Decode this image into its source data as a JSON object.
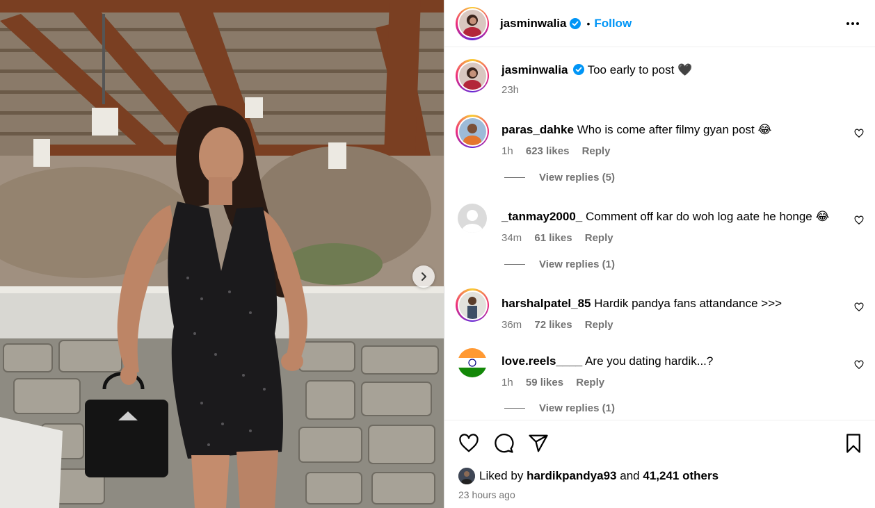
{
  "post": {
    "author": "jasminwalia",
    "follow_label": "Follow",
    "separator": "•",
    "caption": "Too early to post 🖤",
    "caption_time": "23h"
  },
  "comments": [
    {
      "user": "paras_dahke",
      "text": "Who is come after filmy gyan post 😂",
      "time": "1h",
      "likes": "623 likes",
      "reply": "Reply",
      "view_replies": "View replies (5)"
    },
    {
      "user": "_tanmay2000_",
      "text": "Comment off kar do woh log aate he honge 😂",
      "time": "34m",
      "likes": "61 likes",
      "reply": "Reply",
      "view_replies": "View replies (1)"
    },
    {
      "user": "harshalpatel_85",
      "text": "Hardik pandya fans attandance >>>",
      "time": "36m",
      "likes": "72 likes",
      "reply": "Reply"
    },
    {
      "user": "love.reels____",
      "text": "Are you dating hardik...?",
      "time": "1h",
      "likes": "59 likes",
      "reply": "Reply",
      "view_replies": "View replies (1)"
    }
  ],
  "likes": {
    "prefix": "Liked by",
    "user": "hardikpandya93",
    "and": "and",
    "others": "41,241 others"
  },
  "timestamp": "23 hours ago",
  "colors": {
    "accent": "#0095f6",
    "verified": "#0095f6",
    "muted": "#737373"
  },
  "icons": [
    "verified-icon",
    "more-options-icon",
    "heart-icon",
    "comment-icon",
    "share-icon",
    "bookmark-icon",
    "chevron-right-icon"
  ]
}
